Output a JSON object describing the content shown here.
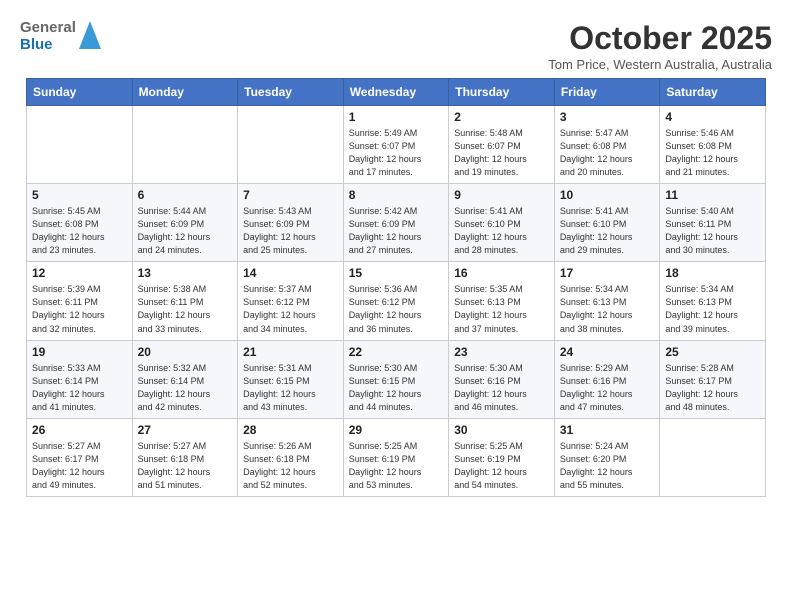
{
  "header": {
    "logo": {
      "general": "General",
      "blue": "Blue"
    },
    "title": "October 2025",
    "subtitle": "Tom Price, Western Australia, Australia"
  },
  "calendar": {
    "days_of_week": [
      "Sunday",
      "Monday",
      "Tuesday",
      "Wednesday",
      "Thursday",
      "Friday",
      "Saturday"
    ],
    "weeks": [
      [
        {
          "day": "",
          "info": ""
        },
        {
          "day": "",
          "info": ""
        },
        {
          "day": "",
          "info": ""
        },
        {
          "day": "1",
          "info": "Sunrise: 5:49 AM\nSunset: 6:07 PM\nDaylight: 12 hours\nand 17 minutes."
        },
        {
          "day": "2",
          "info": "Sunrise: 5:48 AM\nSunset: 6:07 PM\nDaylight: 12 hours\nand 19 minutes."
        },
        {
          "day": "3",
          "info": "Sunrise: 5:47 AM\nSunset: 6:08 PM\nDaylight: 12 hours\nand 20 minutes."
        },
        {
          "day": "4",
          "info": "Sunrise: 5:46 AM\nSunset: 6:08 PM\nDaylight: 12 hours\nand 21 minutes."
        }
      ],
      [
        {
          "day": "5",
          "info": "Sunrise: 5:45 AM\nSunset: 6:08 PM\nDaylight: 12 hours\nand 23 minutes."
        },
        {
          "day": "6",
          "info": "Sunrise: 5:44 AM\nSunset: 6:09 PM\nDaylight: 12 hours\nand 24 minutes."
        },
        {
          "day": "7",
          "info": "Sunrise: 5:43 AM\nSunset: 6:09 PM\nDaylight: 12 hours\nand 25 minutes."
        },
        {
          "day": "8",
          "info": "Sunrise: 5:42 AM\nSunset: 6:09 PM\nDaylight: 12 hours\nand 27 minutes."
        },
        {
          "day": "9",
          "info": "Sunrise: 5:41 AM\nSunset: 6:10 PM\nDaylight: 12 hours\nand 28 minutes."
        },
        {
          "day": "10",
          "info": "Sunrise: 5:41 AM\nSunset: 6:10 PM\nDaylight: 12 hours\nand 29 minutes."
        },
        {
          "day": "11",
          "info": "Sunrise: 5:40 AM\nSunset: 6:11 PM\nDaylight: 12 hours\nand 30 minutes."
        }
      ],
      [
        {
          "day": "12",
          "info": "Sunrise: 5:39 AM\nSunset: 6:11 PM\nDaylight: 12 hours\nand 32 minutes."
        },
        {
          "day": "13",
          "info": "Sunrise: 5:38 AM\nSunset: 6:11 PM\nDaylight: 12 hours\nand 33 minutes."
        },
        {
          "day": "14",
          "info": "Sunrise: 5:37 AM\nSunset: 6:12 PM\nDaylight: 12 hours\nand 34 minutes."
        },
        {
          "day": "15",
          "info": "Sunrise: 5:36 AM\nSunset: 6:12 PM\nDaylight: 12 hours\nand 36 minutes."
        },
        {
          "day": "16",
          "info": "Sunrise: 5:35 AM\nSunset: 6:13 PM\nDaylight: 12 hours\nand 37 minutes."
        },
        {
          "day": "17",
          "info": "Sunrise: 5:34 AM\nSunset: 6:13 PM\nDaylight: 12 hours\nand 38 minutes."
        },
        {
          "day": "18",
          "info": "Sunrise: 5:34 AM\nSunset: 6:13 PM\nDaylight: 12 hours\nand 39 minutes."
        }
      ],
      [
        {
          "day": "19",
          "info": "Sunrise: 5:33 AM\nSunset: 6:14 PM\nDaylight: 12 hours\nand 41 minutes."
        },
        {
          "day": "20",
          "info": "Sunrise: 5:32 AM\nSunset: 6:14 PM\nDaylight: 12 hours\nand 42 minutes."
        },
        {
          "day": "21",
          "info": "Sunrise: 5:31 AM\nSunset: 6:15 PM\nDaylight: 12 hours\nand 43 minutes."
        },
        {
          "day": "22",
          "info": "Sunrise: 5:30 AM\nSunset: 6:15 PM\nDaylight: 12 hours\nand 44 minutes."
        },
        {
          "day": "23",
          "info": "Sunrise: 5:30 AM\nSunset: 6:16 PM\nDaylight: 12 hours\nand 46 minutes."
        },
        {
          "day": "24",
          "info": "Sunrise: 5:29 AM\nSunset: 6:16 PM\nDaylight: 12 hours\nand 47 minutes."
        },
        {
          "day": "25",
          "info": "Sunrise: 5:28 AM\nSunset: 6:17 PM\nDaylight: 12 hours\nand 48 minutes."
        }
      ],
      [
        {
          "day": "26",
          "info": "Sunrise: 5:27 AM\nSunset: 6:17 PM\nDaylight: 12 hours\nand 49 minutes."
        },
        {
          "day": "27",
          "info": "Sunrise: 5:27 AM\nSunset: 6:18 PM\nDaylight: 12 hours\nand 51 minutes."
        },
        {
          "day": "28",
          "info": "Sunrise: 5:26 AM\nSunset: 6:18 PM\nDaylight: 12 hours\nand 52 minutes."
        },
        {
          "day": "29",
          "info": "Sunrise: 5:25 AM\nSunset: 6:19 PM\nDaylight: 12 hours\nand 53 minutes."
        },
        {
          "day": "30",
          "info": "Sunrise: 5:25 AM\nSunset: 6:19 PM\nDaylight: 12 hours\nand 54 minutes."
        },
        {
          "day": "31",
          "info": "Sunrise: 5:24 AM\nSunset: 6:20 PM\nDaylight: 12 hours\nand 55 minutes."
        },
        {
          "day": "",
          "info": ""
        }
      ]
    ]
  }
}
